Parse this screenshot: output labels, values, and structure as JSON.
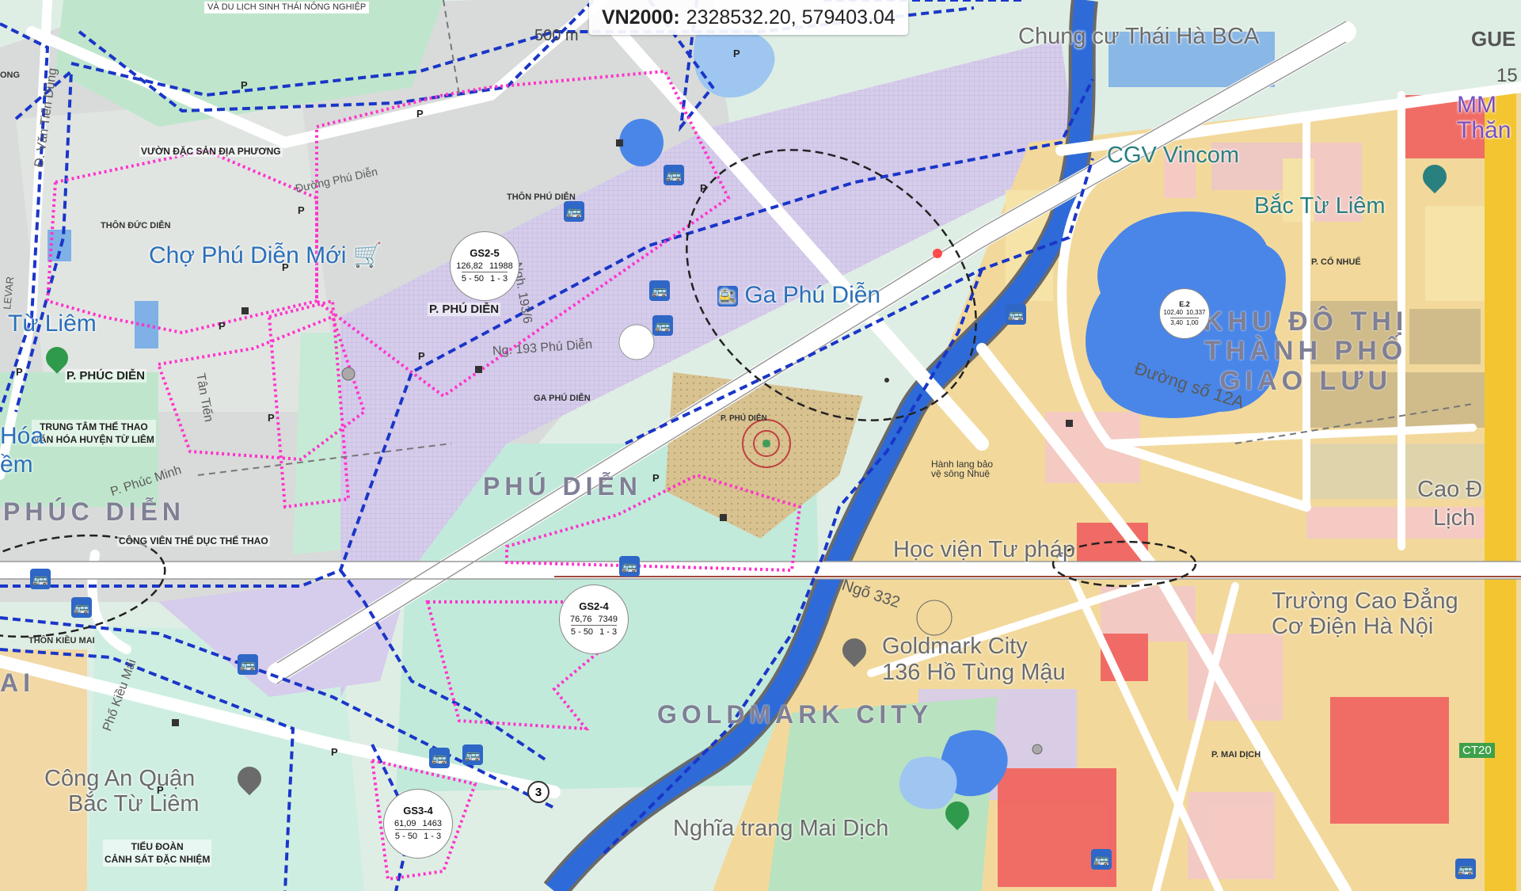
{
  "coordinates": {
    "crs": "VN2000:",
    "value": "2328532.20, 579403.04"
  },
  "scale": {
    "label": "500 m"
  },
  "top_left_label": "VÀ DU LỊCH SINH THÁI NÔNG NGHIỆP",
  "labels": {
    "vuon_dac_san": "VƯỜN ĐẶC SẢN ĐỊA PHƯƠNG",
    "thon_duc_dien": "THÔN ĐỨC DIỄN",
    "thon_phu_dien": "THÔN PHÚ DIỄN",
    "cho_phu_dien": "Chợ Phú Diễn Mới",
    "p_phu_dien_1": "P. PHÚ DIỄN",
    "p_phuc_dien": "P. PHÚC DIỄN",
    "trung_tam_line1": "TRUNG TÂM THỂ THAO",
    "trung_tam_line2": "VĂN HÓA HUYỆN TỪ LIÊM",
    "ga_phu_dien_text": "GA PHÚ DIỄN",
    "ga_phu_dien": "Ga Phú Diễn",
    "ng_193": "Ng. 193 Phú Diễn",
    "ngh_193": "Ngh. 193/6",
    "phu_dien_area": "PHÚ DIỄN",
    "phuc_dien_area": "PHÚC DIỄN",
    "cong_vien": "CÔNG VIÊN THỂ DỤC THỂ THAO",
    "thon_kieu_mai": "THÔN KIỀU MAI",
    "cong_an": "Công An Quận",
    "cong_an2": "Bắc Từ Liêm",
    "tieu_doan1": "TIỂU ĐOÀN",
    "tieu_doan2": "CẢNH SÁT ĐẶC NHIỆM",
    "tu_liem": "Từ Liêm",
    "hoa": "Hóa",
    "em": "ềm",
    "ong": "ONG",
    "ai": "AI",
    "chung_cu": "Chung cư Thái Hà BCA",
    "cgv1": "CGV Vincom",
    "cgv2": "Bắc Từ Liêm",
    "mm1": "MM",
    "mm2": "Thăn",
    "gue": "GUE",
    "gue_num": "15",
    "khu_do_thi1": "KHU ĐÔ THỊ",
    "khu_do_thi2": "THÀNH PHỐ",
    "khu_do_thi3": "GIAO LƯU",
    "duong_12a": "Đường số 12A",
    "p_co_nhue": "P. CỔ NHUẾ",
    "hoc_vien": "Học viện Tư pháp",
    "cao1": "Cao Đ",
    "cao2": "Lịch",
    "truong1": "Trường Cao Đẳng",
    "truong2": "Cơ Điện Hà Nội",
    "goldmark1": "Goldmark City",
    "goldmark2": "136 Hồ Tùng Mậu",
    "goldmark_area": "GOLDMARK CITY",
    "nghia_trang": "Nghĩa trang Mai Dịch",
    "p_mai_dich": "P. MAI DỊCH",
    "p_phu_dien_2": "P. PHÚ DIỄN",
    "ngo_332": "Ngõ 332",
    "ha_bao_ve": "Hành lang bảo vệ sông Nhuệ",
    "ct20": "CT20",
    "tan_tien": "Tân Tiến",
    "phuc_minh": "P. Phúc Minh",
    "pho_kieu_mai": "Phố Kiều Mai",
    "dg_van_tien_dung": "Đ. Văn Tiến Dũng",
    "levar": "LEVAR",
    "duong_phu_dien": "Đường Phú Diễn",
    "badge_3": "3"
  },
  "plots": [
    {
      "code": "GS2-5",
      "a": "126,82",
      "b": "11988",
      "c": "5 - 50",
      "d": "1 - 3"
    },
    {
      "code": "GS2-4",
      "a": "76,76",
      "b": "7349",
      "c": "5 - 50",
      "d": "1 - 3"
    },
    {
      "code": "GS3-4",
      "a": "61,09",
      "b": "1463",
      "c": "5 - 50",
      "d": "1 - 3"
    },
    {
      "code": "E.2",
      "a": "102,40",
      "b": "10,337",
      "c": "3,40",
      "d": "1,00"
    }
  ],
  "colors": {
    "residential": "#cfd0d4",
    "park": "#b9e5cf",
    "water": "#2e6bd8",
    "lake": "#4a86e8",
    "urban_purple": "#d6c8ec",
    "yellow_zone": "#f3d99a",
    "tan_zone": "#cdb98a",
    "red_zone": "#f06060",
    "pink_zone": "#f4c8c8",
    "boundary_blue": "#1a36c8",
    "boundary_pink": "#ff33cc"
  }
}
